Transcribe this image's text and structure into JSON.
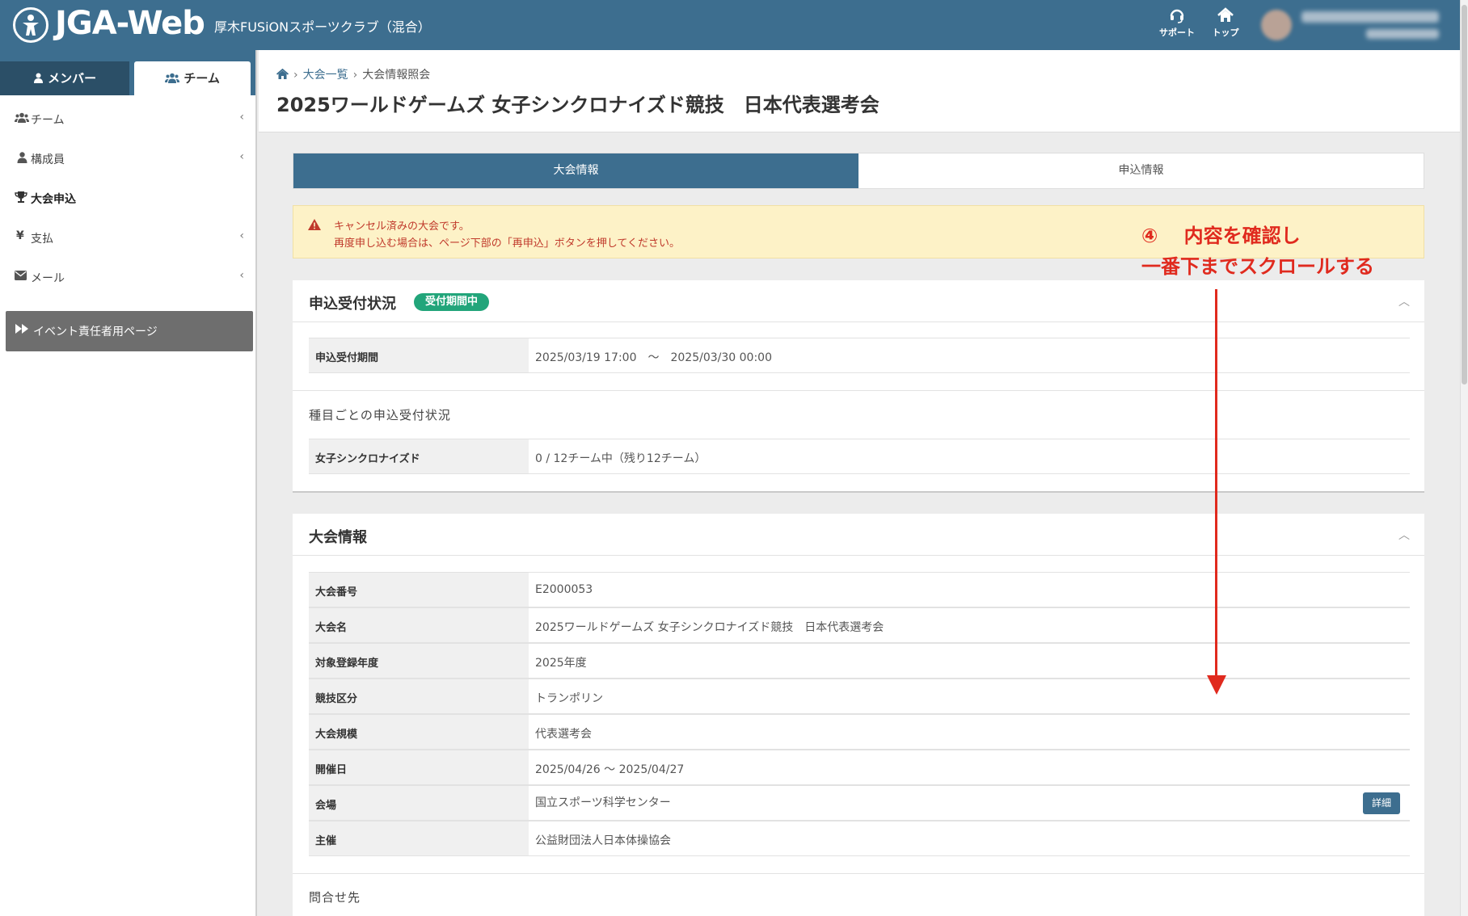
{
  "header": {
    "logo_text": "JGA-Web",
    "club_name": "厚木FUSiONスポーツクラブ（混合）",
    "support_label": "サポート",
    "top_label": "トップ"
  },
  "sidebar": {
    "tab_member": "メンバー",
    "tab_team": "チーム",
    "items": [
      {
        "label": "チーム",
        "icon": "users-icon"
      },
      {
        "label": "構成員",
        "icon": "user-icon"
      },
      {
        "label": "大会申込",
        "icon": "trophy-icon"
      },
      {
        "label": "支払",
        "icon": "yen-icon"
      },
      {
        "label": "メール",
        "icon": "envelope-icon"
      }
    ],
    "event_page": "イベント責任者用ページ"
  },
  "breadcrumb": {
    "list": "大会一覧",
    "current": "大会情報照会"
  },
  "page_title": "2025ワールドゲームズ 女子シンクロナイズド競技　日本代表選考会",
  "tabs": {
    "active": "大会情報",
    "inactive": "申込情報"
  },
  "alert": {
    "line1": "キャンセル済みの大会です。",
    "line2": "再度申し込む場合は、ページ下部の「再申込」ボタンを押してください。"
  },
  "annotation": {
    "line1": "④　 内容を確認し",
    "line2": "一番下までスクロールする"
  },
  "reception": {
    "title": "申込受付状況",
    "badge": "受付期間中",
    "period_label": "申込受付期間",
    "period_value": "2025/03/19 17:00　〜　2025/03/30 00:00",
    "per_event_title": "種目ごとの申込受付状況",
    "event_label": "女子シンクロナイズド",
    "event_value": "0 / 12チーム中（残り12チーム）"
  },
  "info": {
    "title": "大会情報",
    "rows": [
      {
        "k": "大会番号",
        "v": "E2000053"
      },
      {
        "k": "大会名",
        "v": "2025ワールドゲームズ 女子シンクロナイズド競技　日本代表選考会"
      },
      {
        "k": "対象登録年度",
        "v": "2025年度"
      },
      {
        "k": "競技区分",
        "v": "トランポリン"
      },
      {
        "k": "大会規模",
        "v": "代表選考会"
      },
      {
        "k": "開催日",
        "v": "2025/04/26 〜 2025/04/27"
      },
      {
        "k": "会場",
        "v": "国立スポーツ科学センター"
      },
      {
        "k": "主催",
        "v": "公益財団法人日本体操協会"
      }
    ],
    "detail_button": "詳細",
    "contact_title": "問合せ先"
  },
  "colors": {
    "primary": "#3d6e8f",
    "alert_bg": "#fdf2c7",
    "alert_text": "#c0392b",
    "badge": "#22a57a",
    "annotation": "#e02a1e"
  }
}
